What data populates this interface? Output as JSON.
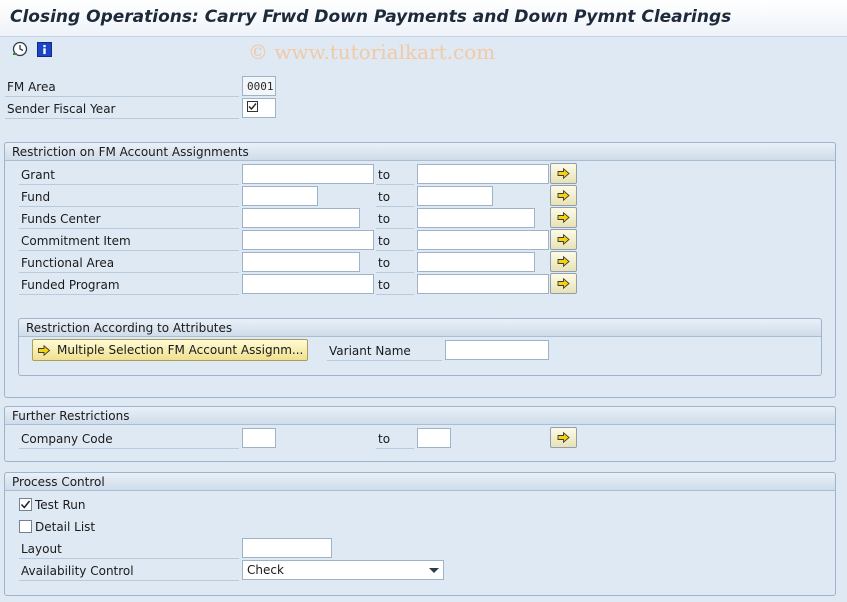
{
  "header": {
    "title": "Closing Operations: Carry Frwd Down Payments and Down Pymnt Clearings",
    "watermark": "© www.tutorialkart.com"
  },
  "toolbar": {
    "icons": [
      "execute-clock-icon",
      "info-icon"
    ]
  },
  "top_fields": {
    "fm_area": {
      "label": "FM Area",
      "value": "0001"
    },
    "sender_fiscal_year": {
      "label": "Sender Fiscal Year",
      "value": ""
    }
  },
  "restriction_fm": {
    "title": "Restriction on FM Account Assignments",
    "to_label": "to",
    "rows": [
      {
        "label": "Grant",
        "from": "",
        "to": ""
      },
      {
        "label": "Fund",
        "from": "",
        "to": ""
      },
      {
        "label": "Funds Center",
        "from": "",
        "to": ""
      },
      {
        "label": "Commitment Item",
        "from": "",
        "to": ""
      },
      {
        "label": "Functional Area",
        "from": "",
        "to": ""
      },
      {
        "label": "Funded Program",
        "from": "",
        "to": ""
      }
    ],
    "attributes": {
      "title": "Restriction According to Attributes",
      "multi_button": "Multiple Selection FM Account Assignm...",
      "variant_label": "Variant Name",
      "variant_value": ""
    }
  },
  "further": {
    "title": "Further Restrictions",
    "company_code": {
      "label": "Company Code",
      "from": "",
      "to": "",
      "to_label": "to"
    }
  },
  "process": {
    "title": "Process Control",
    "test_run": {
      "label": "Test Run",
      "checked": true
    },
    "detail_list": {
      "label": "Detail List",
      "checked": false
    },
    "layout": {
      "label": "Layout",
      "value": ""
    },
    "availability": {
      "label": "Availability Control",
      "value": "Check"
    }
  }
}
